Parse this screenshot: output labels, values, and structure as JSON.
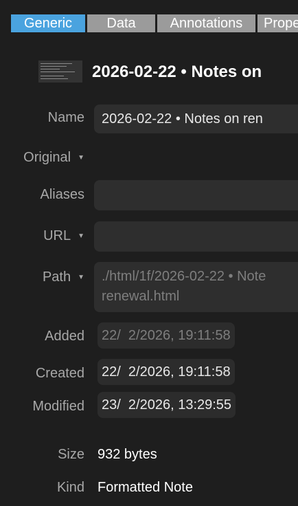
{
  "tabs": [
    {
      "label": "Generic",
      "active": true
    },
    {
      "label": "Data",
      "active": false
    },
    {
      "label": "Annotations",
      "active": false
    },
    {
      "label": "Prope",
      "active": false
    }
  ],
  "header": {
    "title": "2026-02-22 • Notes on",
    "thumbnail_icon": "note-thumbnail"
  },
  "fields": {
    "name": {
      "label": "Name",
      "value": "2026-02-22 • Notes on ren"
    },
    "original": {
      "label": "Original"
    },
    "aliases": {
      "label": "Aliases",
      "value": ""
    },
    "url": {
      "label": "URL",
      "value": ""
    },
    "path": {
      "label": "Path",
      "line1": "./html/1f/2026-02-22 • Note",
      "line2": "renewal.html"
    },
    "added": {
      "label": "Added",
      "value": "22/  2/2026, 19:11:58"
    },
    "created": {
      "label": "Created",
      "value": "22/  2/2026, 19:11:58"
    },
    "modified": {
      "label": "Modified",
      "value": "23/  2/2026, 13:29:55"
    },
    "size": {
      "label": "Size",
      "value": "932 bytes"
    },
    "kind": {
      "label": "Kind",
      "value": "Formatted Note"
    }
  },
  "colors": {
    "background": "#1e1e1e",
    "tab_active": "#4aa3df",
    "tab_inactive": "#9b9b9b",
    "field": "#2e2e2e",
    "label": "#a8a8a8"
  }
}
